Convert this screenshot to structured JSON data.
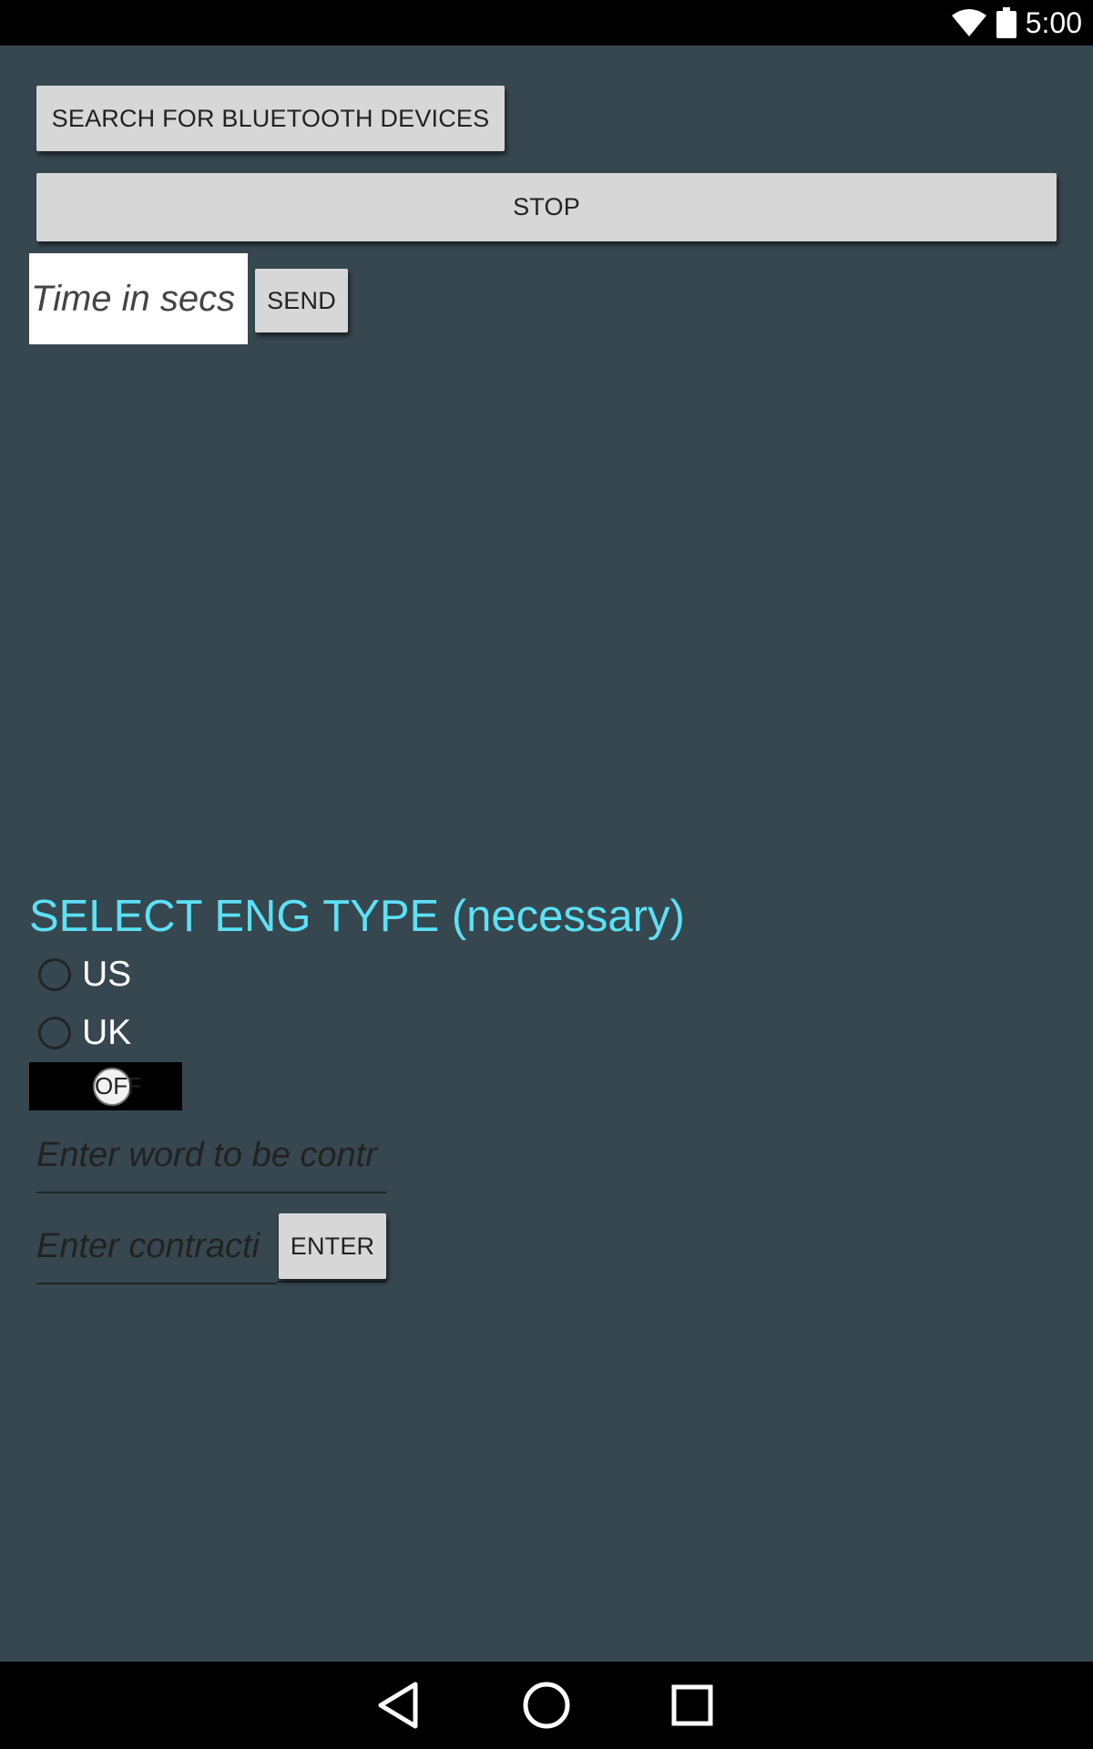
{
  "status_bar": {
    "time": "5:00",
    "icons": [
      "wifi-icon",
      "battery-icon"
    ]
  },
  "buttons": {
    "search": "SEARCH FOR BLUETOOTH DEVICES",
    "stop": "STOP",
    "send": "SEND",
    "enter": "ENTER"
  },
  "time_input": {
    "placeholder": "Time in secs"
  },
  "eng_type": {
    "title": "SELECT ENG TYPE (necessary)",
    "options": [
      "US",
      "UK"
    ],
    "selected": null
  },
  "toggle": {
    "state": "OFF"
  },
  "word_input": {
    "placeholder": "Enter word to be contr"
  },
  "contraction_input": {
    "placeholder": "Enter contracti"
  },
  "nav_bar": {
    "icons": [
      "back-icon",
      "home-icon",
      "recents-icon"
    ]
  },
  "colors": {
    "background": "#37474f",
    "accent": "#5ce1f6",
    "button": "#d7d7d7"
  }
}
